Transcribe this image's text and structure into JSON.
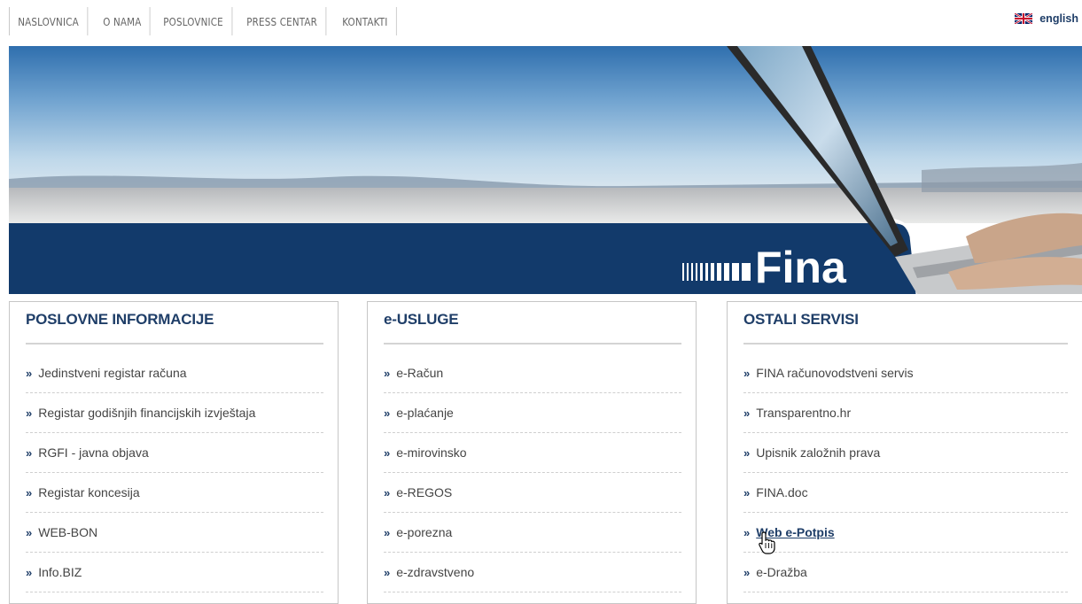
{
  "nav": {
    "items": [
      {
        "label": "NASLOVNICA"
      },
      {
        "label": "O NAMA"
      },
      {
        "label": "POSLOVNICE"
      },
      {
        "label": "PRESS CENTAR"
      },
      {
        "label": "KONTAKTI"
      }
    ],
    "language": {
      "label": "english",
      "flag_icon": "uk-flag-icon"
    }
  },
  "banner": {
    "logo_text": "Fina",
    "colors": {
      "brand": "#123a6b",
      "sky": "#9fc3df"
    }
  },
  "columns": [
    {
      "title": "POSLOVNE INFORMACIJE",
      "links": [
        {
          "label": "Jedinstveni registar računa"
        },
        {
          "label": "Registar godišnjih financijskih izvještaja"
        },
        {
          "label": "RGFI - javna objava"
        },
        {
          "label": "Registar koncesija"
        },
        {
          "label": "WEB-BON"
        },
        {
          "label": "Info.BIZ"
        }
      ]
    },
    {
      "title": "e-USLUGE",
      "links": [
        {
          "label": "e-Račun"
        },
        {
          "label": "e-plaćanje"
        },
        {
          "label": "e-mirovinsko"
        },
        {
          "label": "e-REGOS"
        },
        {
          "label": "e-porezna"
        },
        {
          "label": "e-zdravstveno"
        }
      ]
    },
    {
      "title": "OSTALI SERVISI",
      "links": [
        {
          "label": "FINA računovodstveni servis"
        },
        {
          "label": "Transparentno.hr"
        },
        {
          "label": "Upisnik založnih prava"
        },
        {
          "label": "FINA.doc"
        },
        {
          "label": "Web e-Potpis",
          "hovered": true
        },
        {
          "label": "e-Dražba"
        }
      ]
    }
  ],
  "arrow_glyph": "»"
}
